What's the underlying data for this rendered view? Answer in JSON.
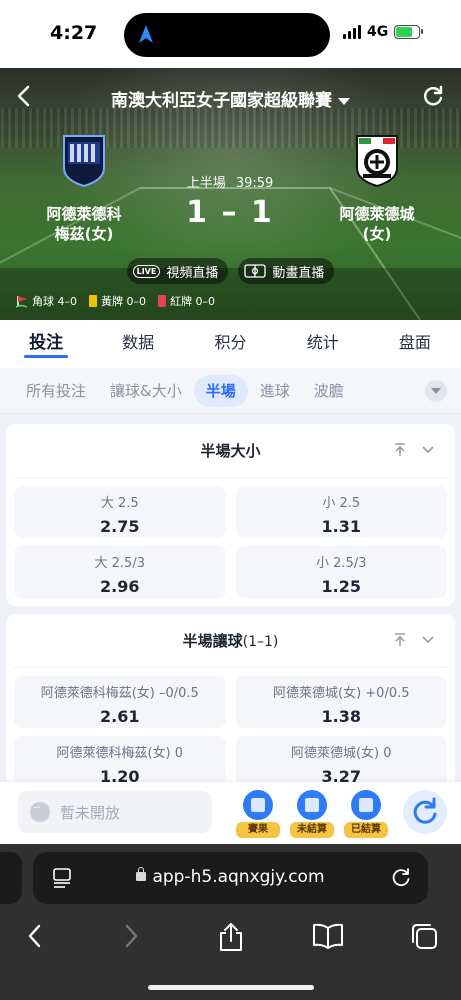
{
  "status": {
    "time": "4:27",
    "network": "4G"
  },
  "match": {
    "league": "南澳大利亞女子國家超級聯賽",
    "home": {
      "name_line1": "阿德萊德科",
      "name_line2": "梅茲(女)"
    },
    "away": {
      "name_line1": "阿德萊德城",
      "name_line2": "(女)"
    },
    "period": "上半場",
    "clock": "39:59",
    "score": "1 – 1",
    "video_live_label": "視頻直播",
    "video_badge": "LIVE",
    "animation_live_label": "動畫直播",
    "stats": {
      "corners": "角球 4–0",
      "yellow": "黃牌 0–0",
      "red": "紅牌 0–0"
    }
  },
  "tabs": [
    "投注",
    "数据",
    "积分",
    "统计",
    "盘面"
  ],
  "subtabs": [
    "所有投注",
    "讓球&大小",
    "半場",
    "進球",
    "波膽"
  ],
  "markets": [
    {
      "title": "半場大小",
      "title_sub": "",
      "odds": [
        {
          "label": "大 2.5",
          "value": "2.75"
        },
        {
          "label": "小 2.5",
          "value": "1.31"
        },
        {
          "label": "大 2.5/3",
          "value": "2.96"
        },
        {
          "label": "小 2.5/3",
          "value": "1.25"
        }
      ]
    },
    {
      "title": "半場讓球",
      "title_sub": "(1–1)",
      "odds": [
        {
          "label": "阿德萊德科梅茲(女) –0/0.5",
          "value": "2.61"
        },
        {
          "label": "阿德萊德城(女) +0/0.5",
          "value": "1.38"
        },
        {
          "label": "阿德萊德科梅茲(女) 0",
          "value": "1.20"
        },
        {
          "label": "阿德萊德城(女) 0",
          "value": "3.27"
        }
      ]
    }
  ],
  "action_bar": {
    "chat_placeholder": "暫未開放",
    "results_label": "賽果",
    "unsettled_label": "未結算",
    "settled_label": "已結算"
  },
  "browser": {
    "url": "app-h5.aqnxgjy.com"
  },
  "colors": {
    "accent": "#2d6bff",
    "corner": "#e23b3b",
    "yellow_card": "#f2c200",
    "red_card": "#e8414d"
  }
}
